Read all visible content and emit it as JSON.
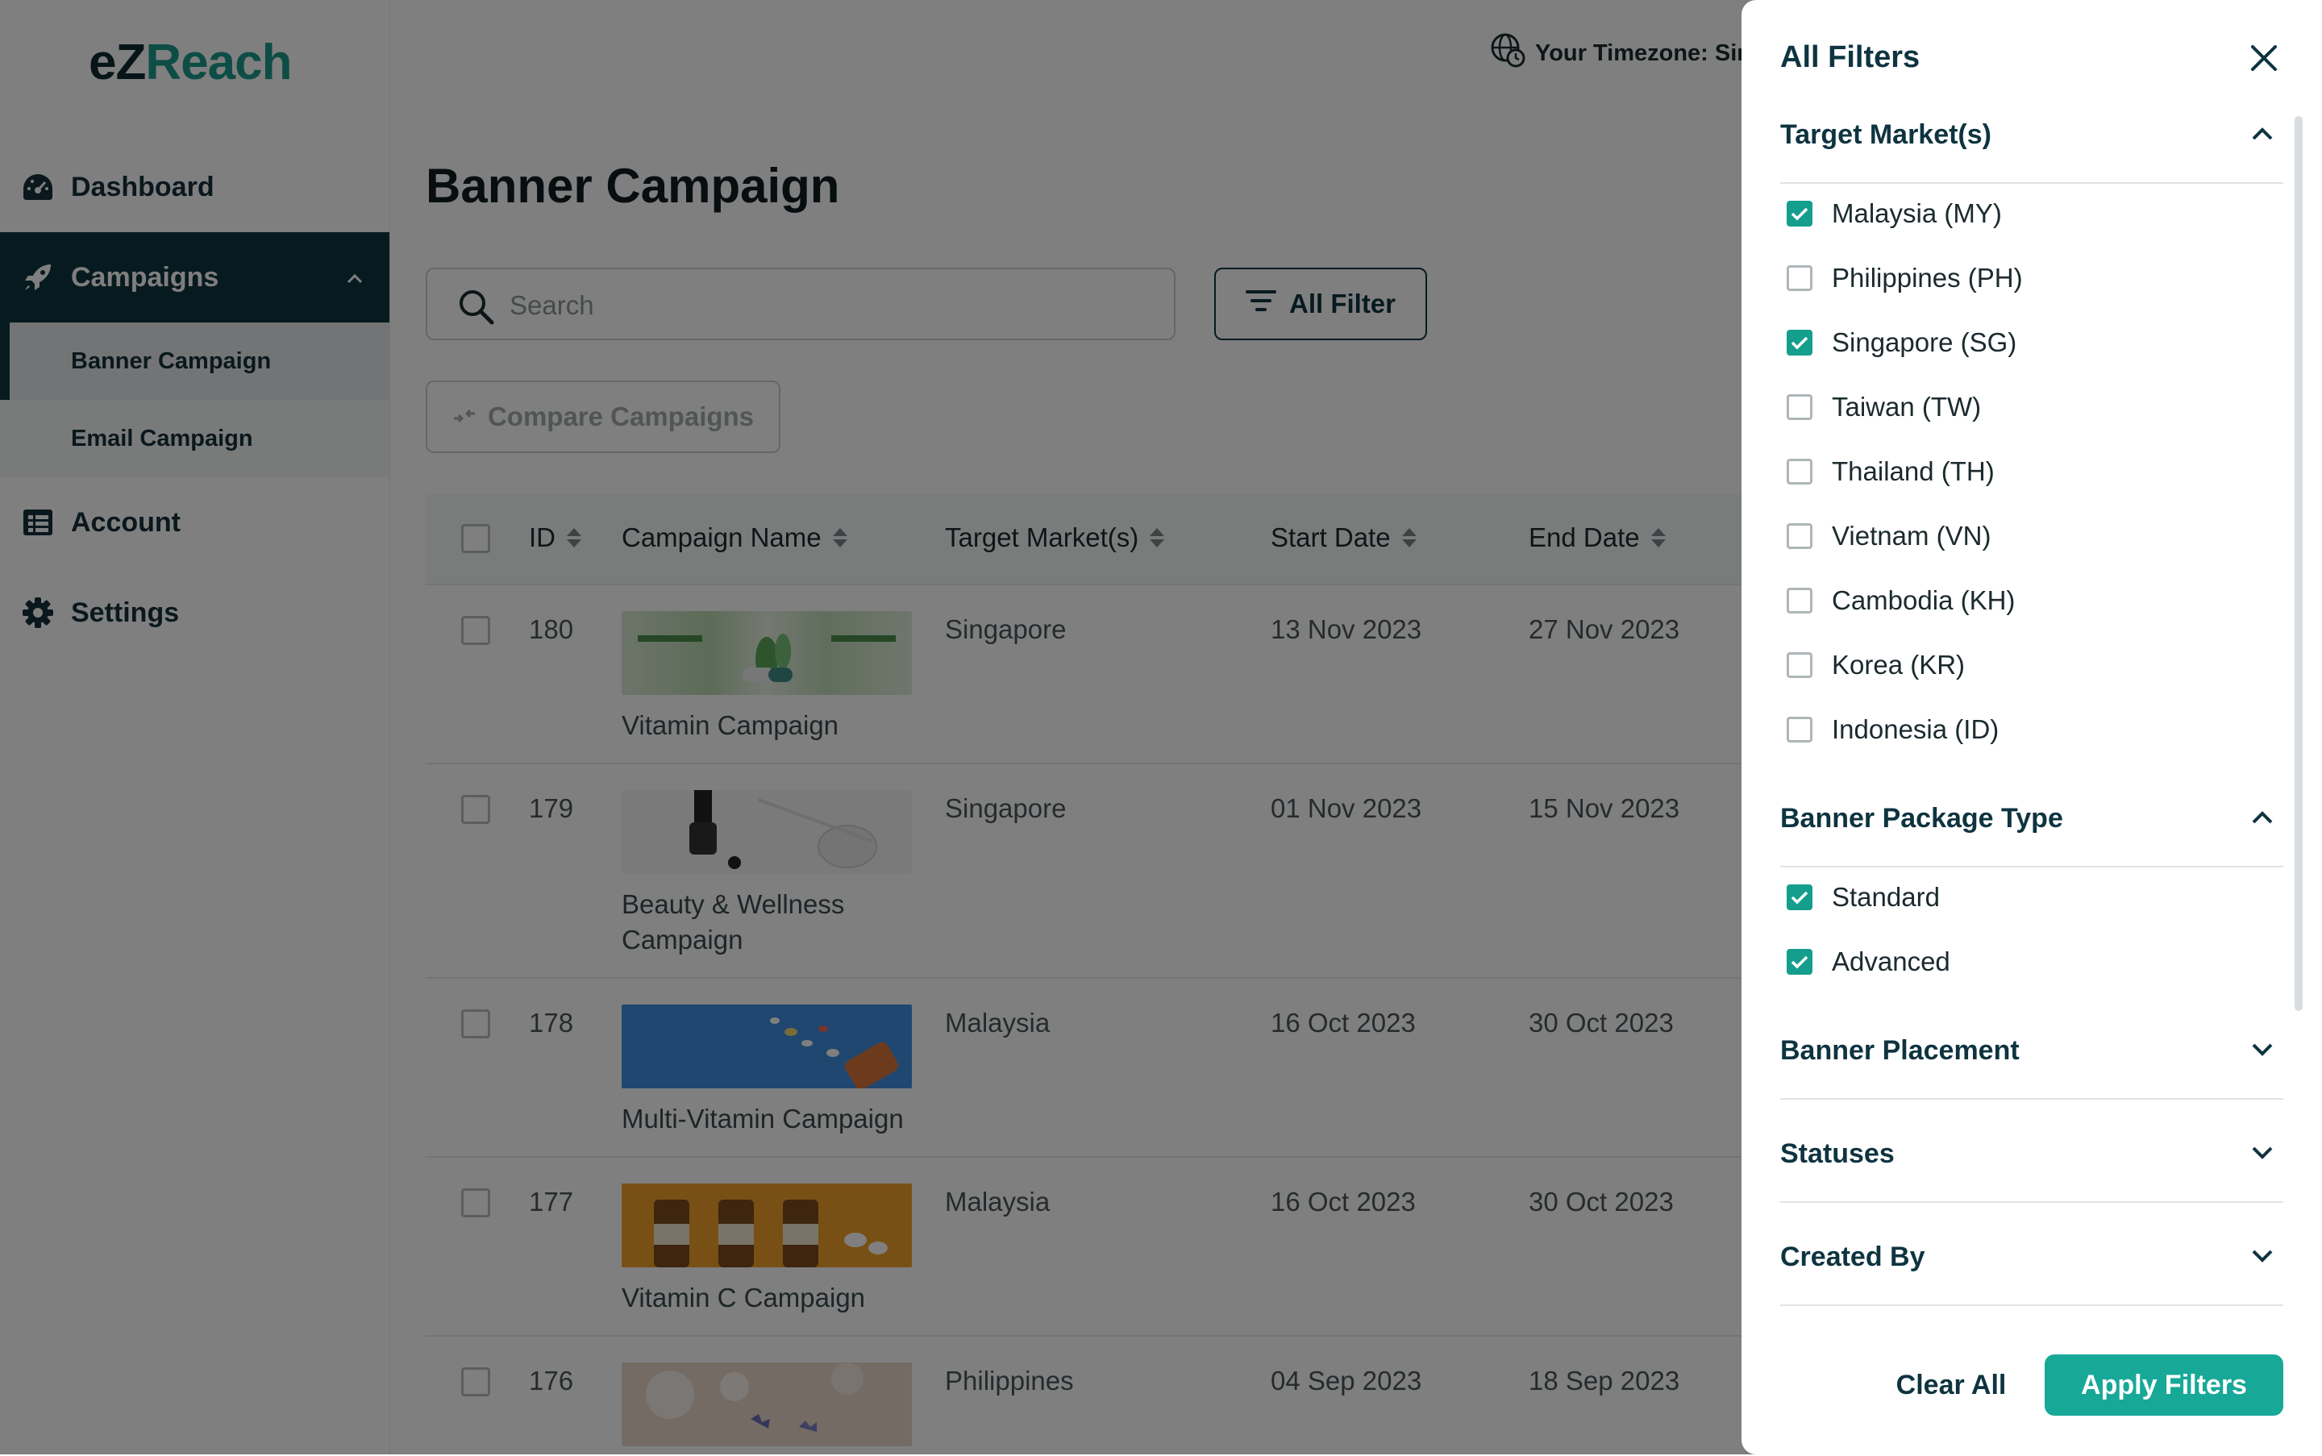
{
  "logo": {
    "e": "e",
    "z": "Z",
    "reach": "Reach"
  },
  "sidebar": {
    "dashboard": "Dashboard",
    "campaigns": "Campaigns",
    "banner_campaign": "Banner Campaign",
    "email_campaign": "Email Campaign",
    "account": "Account",
    "settings": "Settings"
  },
  "header": {
    "timezone": "Your Timezone: Sir"
  },
  "main": {
    "title": "Banner Campaign",
    "search_placeholder": "Search",
    "all_filter": "All Filter",
    "compare": "Compare Campaigns"
  },
  "table": {
    "columns": [
      "ID",
      "Campaign Name",
      "Target Market(s)",
      "Start Date",
      "End Date"
    ],
    "rows": [
      {
        "id": "180",
        "name": "Vitamin Campaign",
        "market": "Singapore",
        "start": "13 Nov 2023",
        "end": "27 Nov 2023"
      },
      {
        "id": "179",
        "name": "Beauty & Wellness Campaign",
        "market": "Singapore",
        "start": "01 Nov 2023",
        "end": "15 Nov 2023"
      },
      {
        "id": "178",
        "name": "Multi-Vitamin Campaign",
        "market": "Malaysia",
        "start": "16 Oct 2023",
        "end": "30 Oct 2023"
      },
      {
        "id": "177",
        "name": "Vitamin C Campaign",
        "market": "Malaysia",
        "start": "16 Oct 2023",
        "end": "30 Oct 2023"
      },
      {
        "id": "176",
        "name": "",
        "market": "Philippines",
        "start": "04 Sep 2023",
        "end": "18 Sep 2023"
      }
    ]
  },
  "drawer": {
    "title": "All Filters",
    "sections": {
      "target_markets": "Target Market(s)",
      "package_type": "Banner Package Type",
      "placement": "Banner Placement",
      "statuses": "Statuses",
      "created_by": "Created By"
    },
    "markets": [
      {
        "label": "Malaysia (MY)",
        "checked": true
      },
      {
        "label": "Philippines (PH)",
        "checked": false
      },
      {
        "label": "Singapore (SG)",
        "checked": true
      },
      {
        "label": "Taiwan (TW)",
        "checked": false
      },
      {
        "label": "Thailand (TH)",
        "checked": false
      },
      {
        "label": "Vietnam (VN)",
        "checked": false
      },
      {
        "label": "Cambodia (KH)",
        "checked": false
      },
      {
        "label": "Korea (KR)",
        "checked": false
      },
      {
        "label": "Indonesia (ID)",
        "checked": false
      }
    ],
    "packages": [
      {
        "label": "Standard",
        "checked": true
      },
      {
        "label": "Advanced",
        "checked": true
      }
    ],
    "clear_all": "Clear All",
    "apply": "Apply Filters"
  },
  "colors": {
    "primary": "#0e3440",
    "accent": "#17a898",
    "check": "#149e8e"
  }
}
